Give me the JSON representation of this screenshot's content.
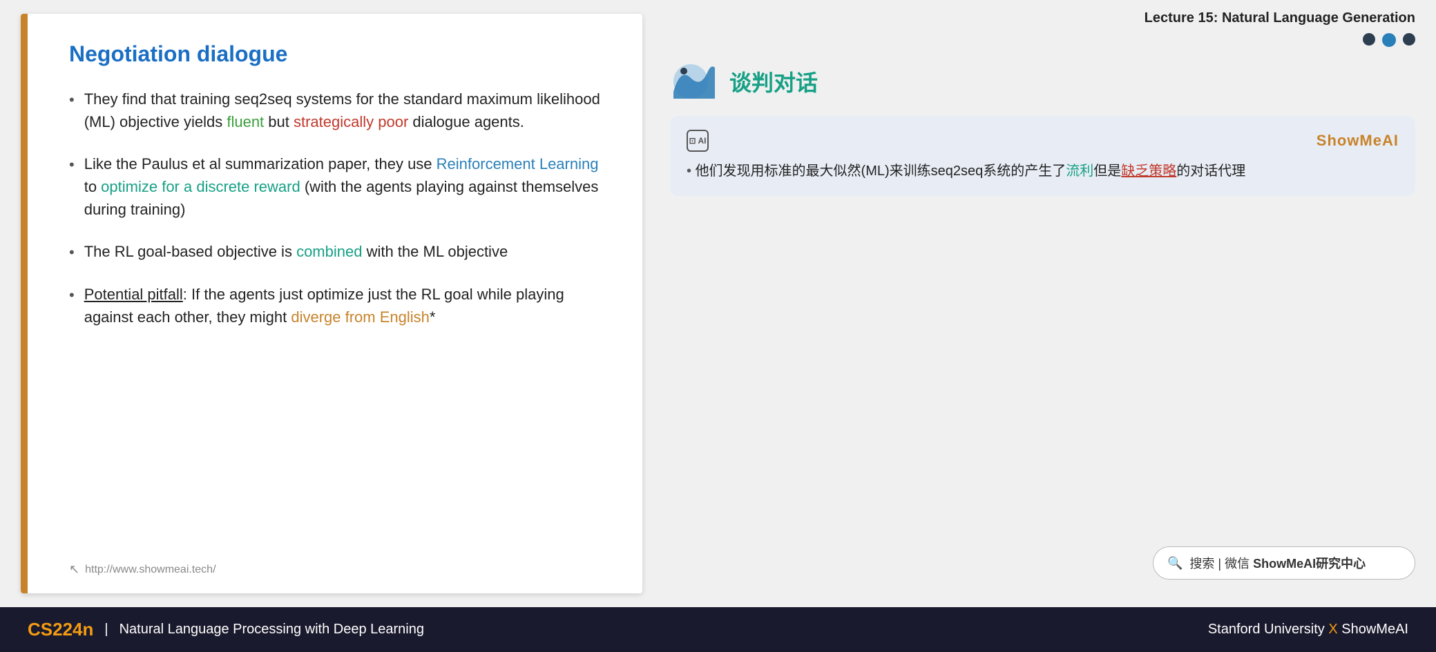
{
  "slide": {
    "title": "Negotiation dialogue",
    "border_color": "#c8832a",
    "bullets": [
      {
        "id": "bullet1",
        "parts": [
          {
            "text": "They find that training seq2seq systems for the standard maximum likelihood (ML) objective yields ",
            "style": "normal"
          },
          {
            "text": "fluent",
            "style": "green"
          },
          {
            "text": " but ",
            "style": "normal"
          },
          {
            "text": "strategically poor",
            "style": "red"
          },
          {
            "text": " dialogue agents.",
            "style": "normal"
          }
        ]
      },
      {
        "id": "bullet2",
        "parts": [
          {
            "text": "Like the Paulus et al summarization paper, they use ",
            "style": "normal"
          },
          {
            "text": "Reinforcement Learning",
            "style": "blue"
          },
          {
            "text": " to ",
            "style": "normal"
          },
          {
            "text": "optimize for a discrete reward",
            "style": "teal"
          },
          {
            "text": " (with the agents playing against themselves during training)",
            "style": "normal"
          }
        ]
      },
      {
        "id": "bullet3",
        "parts": [
          {
            "text": "The RL goal-based objective is ",
            "style": "normal"
          },
          {
            "text": "combined",
            "style": "teal"
          },
          {
            "text": " with the ML objective",
            "style": "normal"
          }
        ]
      },
      {
        "id": "bullet4",
        "parts": [
          {
            "text": "Potential pitfall",
            "style": "underline"
          },
          {
            "text": ": If the agents just optimize just the RL goal while playing against each other, they might ",
            "style": "normal"
          },
          {
            "text": "diverge from English",
            "style": "orange"
          },
          {
            "text": "*",
            "style": "normal"
          }
        ]
      }
    ],
    "url": "http://www.showmeai.tech/"
  },
  "right_panel": {
    "lecture_title": "Lecture 15: Natural Language Generation",
    "dots": [
      {
        "active": false
      },
      {
        "active": true
      },
      {
        "active": false
      }
    ],
    "chinese_title": "谈判对话",
    "chat": {
      "ai_label": "AI",
      "brand": "ShowMeAI",
      "content_prefix": "他们发现用标准的最大似然(ML)来训练seq2seq系统的产生了",
      "fluent_text": "流利",
      "middle_text": "但是",
      "poor_text": "缺乏策略",
      "content_suffix": "的对话代理"
    },
    "search": {
      "icon": "🔍",
      "text": "搜索 | 微信 ShowMeAI研究中心"
    }
  },
  "footer": {
    "course_code": "CS224n",
    "divider": "|",
    "course_name": "Natural Language Processing with Deep Learning",
    "university": "Stanford University",
    "x_symbol": "X",
    "brand": "ShowMeAI"
  }
}
